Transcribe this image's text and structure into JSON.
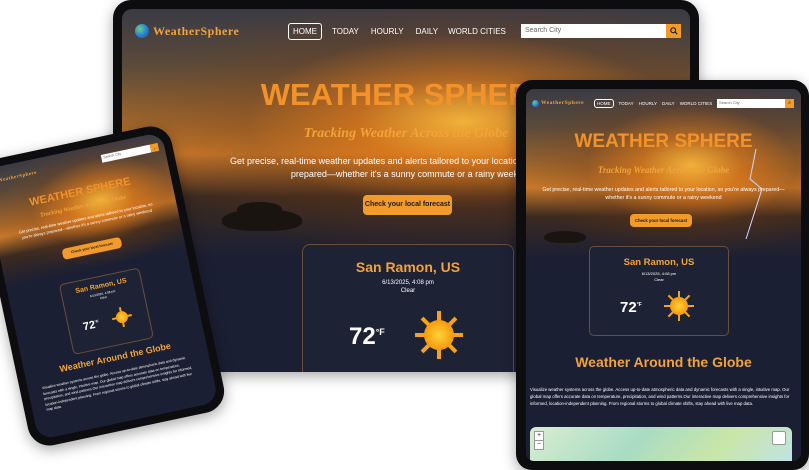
{
  "brand": {
    "name": "WeatherSphere"
  },
  "nav": {
    "home": "HOME",
    "today": "TODAY",
    "hourly": "HOURLY",
    "daily": "DAILY",
    "world": "WORLD CITIES"
  },
  "search": {
    "placeholder": "Search City"
  },
  "hero": {
    "title": "WEATHER SPHERE",
    "tagline": "Tracking Weather Across the Globe",
    "description": "Get precise, real-time weather updates and alerts tailored to your location, so you're always prepared—whether it's a sunny commute or a rainy weekend",
    "cta": "Check your local forecast"
  },
  "weather": {
    "city": "San Ramon, US",
    "datetime": "6/13/2025, 4:08 pm",
    "condition": "Clear",
    "temp": "72",
    "unit": "°F"
  },
  "world": {
    "title": "Weather Around the Globe",
    "text": "Visualize weather systems across the globe. Access up-to-date atmospheric data and dynamic forecasts with a single, intuitive map. Our global map offers accurate data on temperature, precipitation, and wind patterns.Our interactive map delivers comprehensive insights for informed, location-independent planning. From regional storms to global climate shifts, stay ahead with live map data."
  },
  "map": {
    "zoom_in": "+",
    "zoom_out": "−"
  },
  "icons": {
    "sun": "sun-icon",
    "search": "search-icon",
    "globe": "globe-icon",
    "layers": "layers-icon"
  },
  "colors": {
    "accent": "#f2922a",
    "card_bg": "#1e2235",
    "button": "#f29b2a"
  }
}
